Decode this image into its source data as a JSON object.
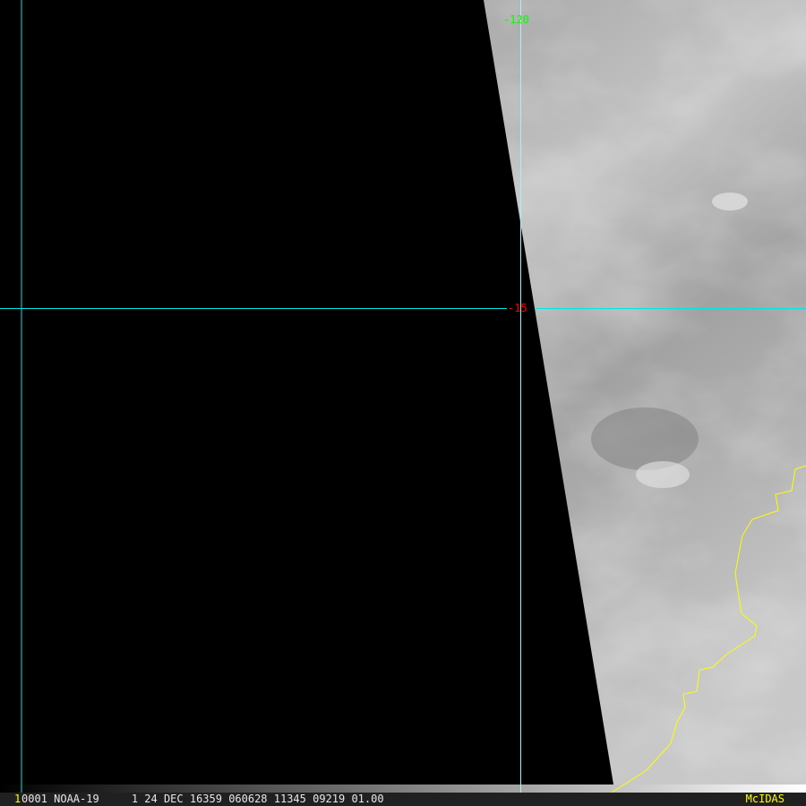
{
  "status_bar": {
    "frame_number": "1",
    "info": "0001 NOAA-19     1 24 DEC 16359 060628 11345 09219 01.00",
    "brand": "McIDAS"
  },
  "grid_labels": {
    "longitude": "-120",
    "latitude": "-15"
  },
  "colors": {
    "grid": "#00e5e5",
    "longitude_label": "#00ff00",
    "latitude_label": "#ff0000",
    "coastline": "#ffff00",
    "brand": "#ffff00"
  }
}
